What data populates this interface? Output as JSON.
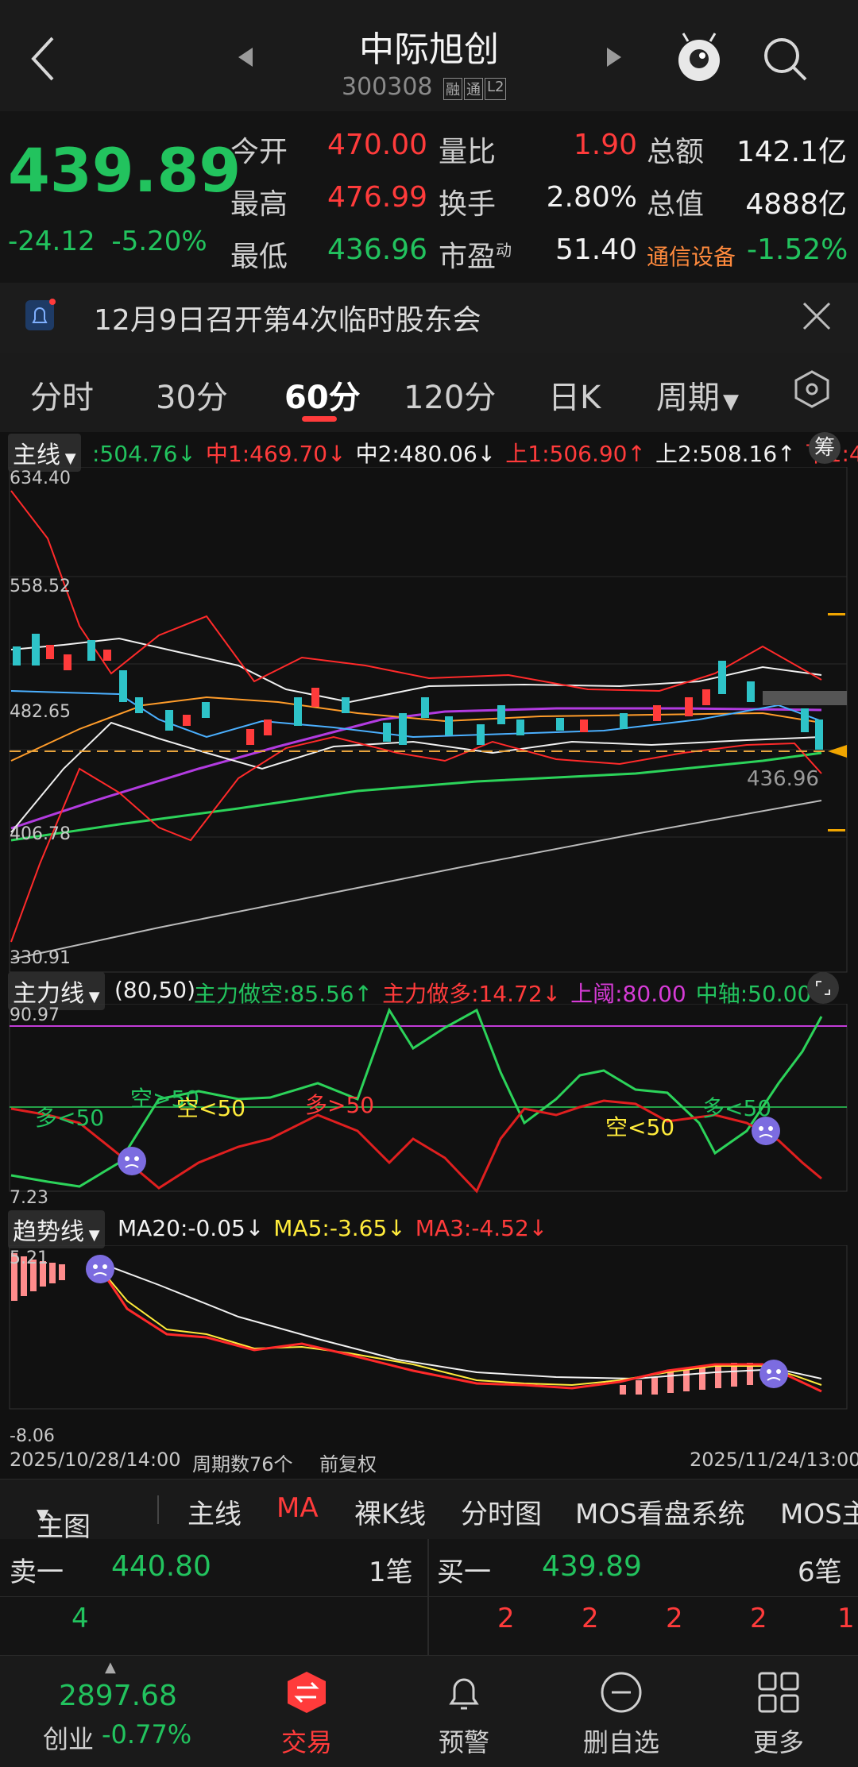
{
  "header": {
    "stock_name": "中际旭创",
    "stock_code": "300308",
    "tags": [
      "融",
      "通",
      "L2"
    ]
  },
  "quote": {
    "price": "439.89",
    "change": "-24.12",
    "change_pct": "-5.20%",
    "open_label": "今开",
    "open": "470.00",
    "high_label": "最高",
    "high": "476.99",
    "low_label": "最低",
    "low": "436.96",
    "vol_ratio_label": "量比",
    "vol_ratio": "1.90",
    "turnover_label": "换手",
    "turnover": "2.80%",
    "pe_label": "市盈",
    "pe_sup": "动",
    "pe": "51.40",
    "amount_label": "总额",
    "amount": "142.1亿",
    "mktcap_label": "总值",
    "mktcap": "4888亿",
    "sector": "通信设备",
    "sector_pct": "-1.52%"
  },
  "notice": {
    "text": "12月9日召开第4次临时股东会"
  },
  "tabs": [
    "分时",
    "30分",
    "60分",
    "120分",
    "日K",
    "周期"
  ],
  "active_tab": "60分",
  "main_chart": {
    "indicator": "主线",
    "legend": [
      {
        "text": ":504.76",
        "arrow": "↓",
        "color": "#22c35e"
      },
      {
        "text": "中1:469.70",
        "arrow": "↓",
        "color": "#ff3b3b"
      },
      {
        "text": "中2:480.06",
        "arrow": "↓",
        "color": "#f2f2f2"
      },
      {
        "text": "上1:506.90",
        "arrow": "↑",
        "color": "#ff3b3b"
      },
      {
        "text": "上2:508.16",
        "arrow": "↑",
        "color": "#f2f2f2"
      },
      {
        "text": "下1:4",
        "arrow": "",
        "color": "#ff3b3b"
      }
    ],
    "chip_label": "筹",
    "y_labels": [
      "634.40",
      "558.52",
      "482.65",
      "406.78",
      "330.91"
    ],
    "current_label": "436.96"
  },
  "sub1": {
    "indicator": "主力线",
    "param": "(80,50)",
    "legend": [
      {
        "text": "主力做空:85.56",
        "arrow": "↑",
        "color": "#22c35e"
      },
      {
        "text": "主力做多:14.72",
        "arrow": "↓",
        "color": "#ff3b3b"
      },
      {
        "text": "上阈:80.00",
        "arrow": "",
        "color": "#d63bd6"
      },
      {
        "text": "中轴:50.00",
        "arrow": "",
        "color": "#22c35e"
      }
    ],
    "y_top": "90.97",
    "y_bottom": "7.23",
    "annotations": [
      {
        "text": "多<50",
        "color": "#22c35e"
      },
      {
        "text": "空>50",
        "color": "#22c35e"
      },
      {
        "text": "空<50",
        "color": "#ffeb3b"
      },
      {
        "text": "多>50",
        "color": "#ff3b3b"
      },
      {
        "text": "空<50",
        "color": "#ffeb3b"
      },
      {
        "text": "多<50",
        "color": "#22c35e"
      }
    ]
  },
  "sub2": {
    "indicator": "趋势线",
    "legend": [
      {
        "text": "MA20:-0.05",
        "arrow": "↓",
        "color": "#f2f2f2"
      },
      {
        "text": "MA5:-3.65",
        "arrow": "↓",
        "color": "#ffeb3b"
      },
      {
        "text": "MA3:-4.52",
        "arrow": "↓",
        "color": "#ff3b3b"
      }
    ],
    "y_top": "5.21",
    "y_bottom": "-8.06"
  },
  "time_axis": {
    "start": "2025/10/28/14:00",
    "periods": "周期数76个",
    "adjust": "前复权",
    "end": "2025/11/24/13:00"
  },
  "menubar": [
    "主图",
    "主线",
    "MA",
    "裸K线",
    "分时图",
    "MOS看盘系统",
    "MOS主"
  ],
  "orderbook": {
    "sell_label": "卖一",
    "sell_price": "440.80",
    "sell_count": "1笔",
    "buy_label": "买一",
    "buy_price": "439.89",
    "buy_count": "6笔",
    "sell_qty": [
      "4"
    ],
    "buy_qty": [
      "2",
      "2",
      "2",
      "2",
      "1"
    ]
  },
  "bottom_nav": {
    "index_value": "2897.68",
    "index_name": "创业",
    "index_pct": "-0.77%",
    "items": [
      "交易",
      "预警",
      "删自选",
      "更多"
    ]
  },
  "colors": {
    "up": "#ff3b3b",
    "down": "#22c35e",
    "accent": "#ff3b3b",
    "bg": "#141414"
  }
}
